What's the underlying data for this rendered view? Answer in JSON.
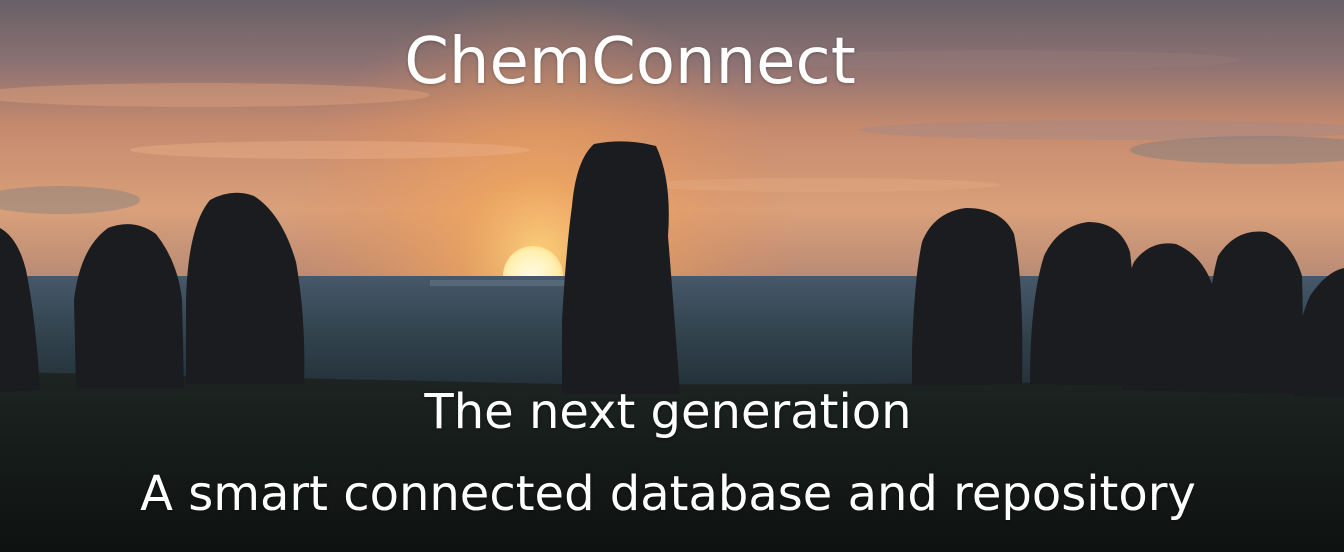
{
  "banner": {
    "title": "ChemConnect",
    "subtitle_line1": "The next generation",
    "subtitle_line2": "A smart connected database and repository"
  },
  "colors": {
    "sky_top": "#6f6a6f",
    "sky_glow": "#e79a5a",
    "sun": "#fff2b8",
    "sea": "#3b4e5a",
    "ground": "#141a18",
    "stone": "#1a1c1f",
    "text": "#ffffff"
  },
  "scene": {
    "description_icons": [
      "standing-stones",
      "sunset-sun",
      "sea-horizon"
    ]
  }
}
